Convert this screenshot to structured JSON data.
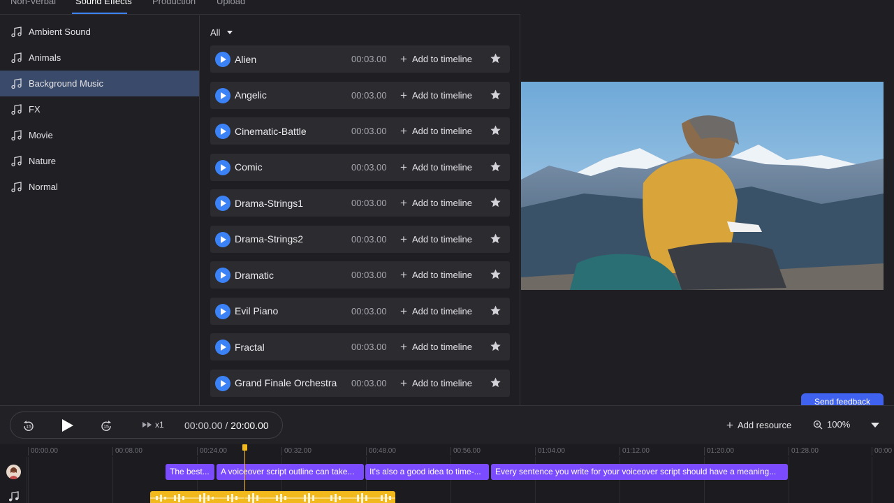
{
  "tabs": [
    {
      "label": "Non-Verbal"
    },
    {
      "label": "Sound Effects"
    },
    {
      "label": "Production"
    },
    {
      "label": "Upload"
    }
  ],
  "categories": [
    {
      "label": "Ambient Sound"
    },
    {
      "label": "Animals"
    },
    {
      "label": "Background Music"
    },
    {
      "label": "FX"
    },
    {
      "label": "Movie"
    },
    {
      "label": "Nature"
    },
    {
      "label": "Normal"
    }
  ],
  "filter": {
    "label": "All"
  },
  "sounds": [
    {
      "name": "Alien",
      "duration": "00:03.00",
      "action": "Add to timeline"
    },
    {
      "name": "Angelic",
      "duration": "00:03.00",
      "action": "Add to timeline"
    },
    {
      "name": "Cinematic-Battle",
      "duration": "00:03.00",
      "action": "Add to timeline"
    },
    {
      "name": "Comic",
      "duration": "00:03.00",
      "action": "Add to timeline"
    },
    {
      "name": "Drama-Strings1",
      "duration": "00:03.00",
      "action": "Add to timeline"
    },
    {
      "name": "Drama-Strings2",
      "duration": "00:03.00",
      "action": "Add to timeline"
    },
    {
      "name": "Dramatic",
      "duration": "00:03.00",
      "action": "Add to timeline"
    },
    {
      "name": "Evil Piano",
      "duration": "00:03.00",
      "action": "Add to timeline"
    },
    {
      "name": "Fractal",
      "duration": "00:03.00",
      "action": "Add to timeline"
    },
    {
      "name": "Grand Finale Orchestra",
      "duration": "00:03.00",
      "action": "Add to timeline"
    }
  ],
  "feedback": {
    "label": "Send feedback"
  },
  "player": {
    "rewind_label": "15",
    "forward_label": "15",
    "speed": "x1",
    "current_time": "00:00.00",
    "separator": " / ",
    "total_time": "20:00.00"
  },
  "toolbar": {
    "add_resource": "Add resource",
    "zoom": "100%"
  },
  "ruler": [
    "00:00.00",
    "00:08.00",
    "00:24.00",
    "00:32.00",
    "00:48.00",
    "00:56.00",
    "01:04.00",
    "01:12.00",
    "01:20.00",
    "01:28.00",
    "00:00"
  ],
  "clips": [
    {
      "text": "The best..."
    },
    {
      "text": "A voiceover script outline can take..."
    },
    {
      "text": "It's also a good idea to time-..."
    },
    {
      "text": "Every sentence you write for your voiceover script should have a meaning..."
    }
  ],
  "colors": {
    "accent": "#3b82f6",
    "selected_category": "#3a4a6b",
    "clip": "#7b4bff",
    "audio": "#f2b91c",
    "feedback": "#3f62f0"
  }
}
